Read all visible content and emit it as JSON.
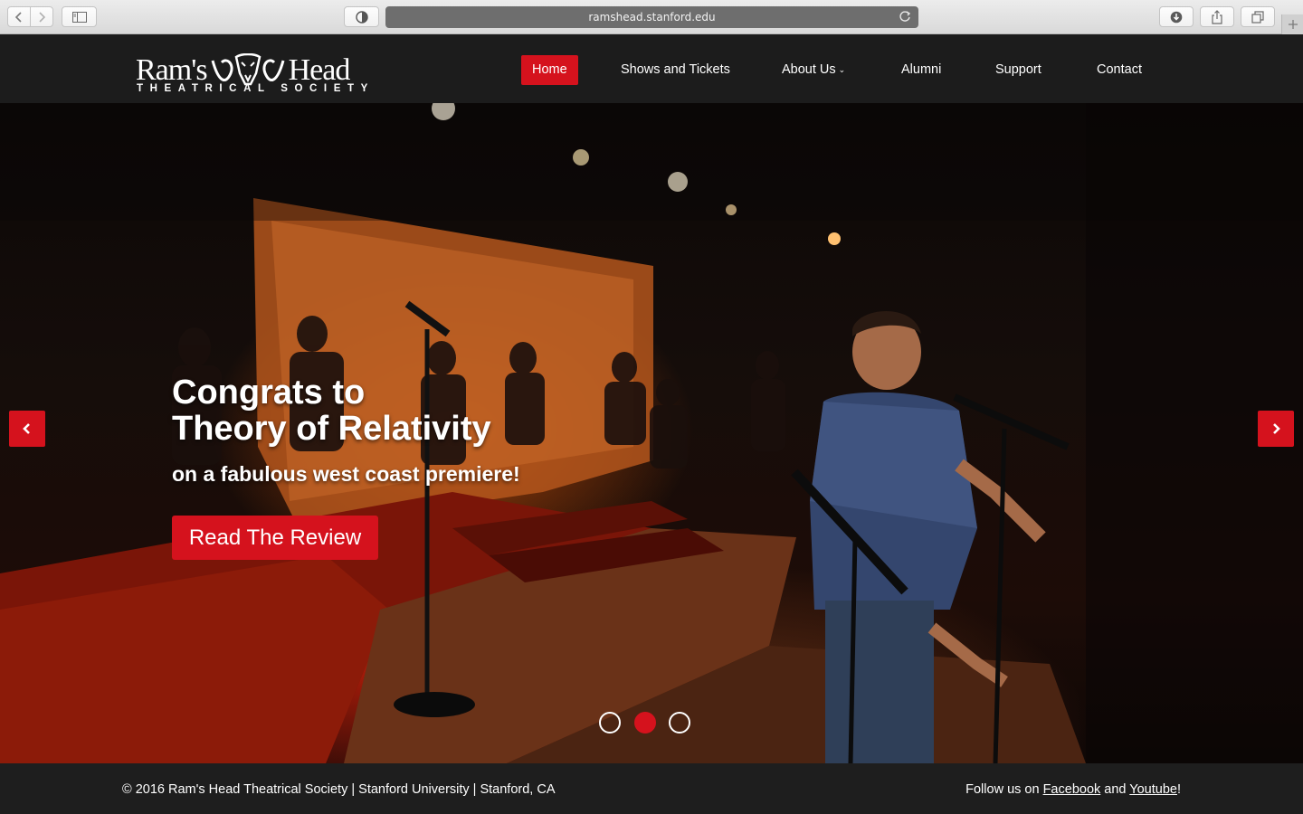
{
  "browser": {
    "url": "ramshead.stanford.edu"
  },
  "logo": {
    "left_word": "Ram's",
    "right_word": "Head",
    "tagline": "THEATRICAL SOCIETY"
  },
  "nav": {
    "items": [
      {
        "label": "Home",
        "active": true
      },
      {
        "label": "Shows and Tickets"
      },
      {
        "label": "About Us",
        "dropdown": true
      },
      {
        "label": "Alumni"
      },
      {
        "label": "Support"
      },
      {
        "label": "Contact"
      }
    ]
  },
  "hero": {
    "title_line1": "Congrats to",
    "title_line2": "Theory of Relativity",
    "subtitle": "on a fabulous west coast premiere!",
    "cta_label": "Read The Review",
    "slides_total": 3,
    "active_slide": 2
  },
  "footer": {
    "copyright": "© 2016 Ram's Head Theatrical Society | Stanford University | Stanford, CA",
    "follow_prefix": "Follow us on ",
    "facebook": "Facebook",
    "and": " and ",
    "youtube": "Youtube",
    "suffix": "!"
  },
  "colors": {
    "accent": "#d5121d",
    "header_bg": "#1c1c1c",
    "footer_bg": "#1e1e1e"
  },
  "icons": {
    "back": "chevron-left-icon",
    "forward": "chevron-right-icon",
    "sidebar": "sidebar-icon",
    "privacy": "privacy-shield-icon",
    "reload": "reload-icon",
    "download": "download-icon",
    "share": "share-icon",
    "tabs": "tabs-icon",
    "new_tab": "plus-icon",
    "logo_mark": "ram-head-logo-icon"
  }
}
